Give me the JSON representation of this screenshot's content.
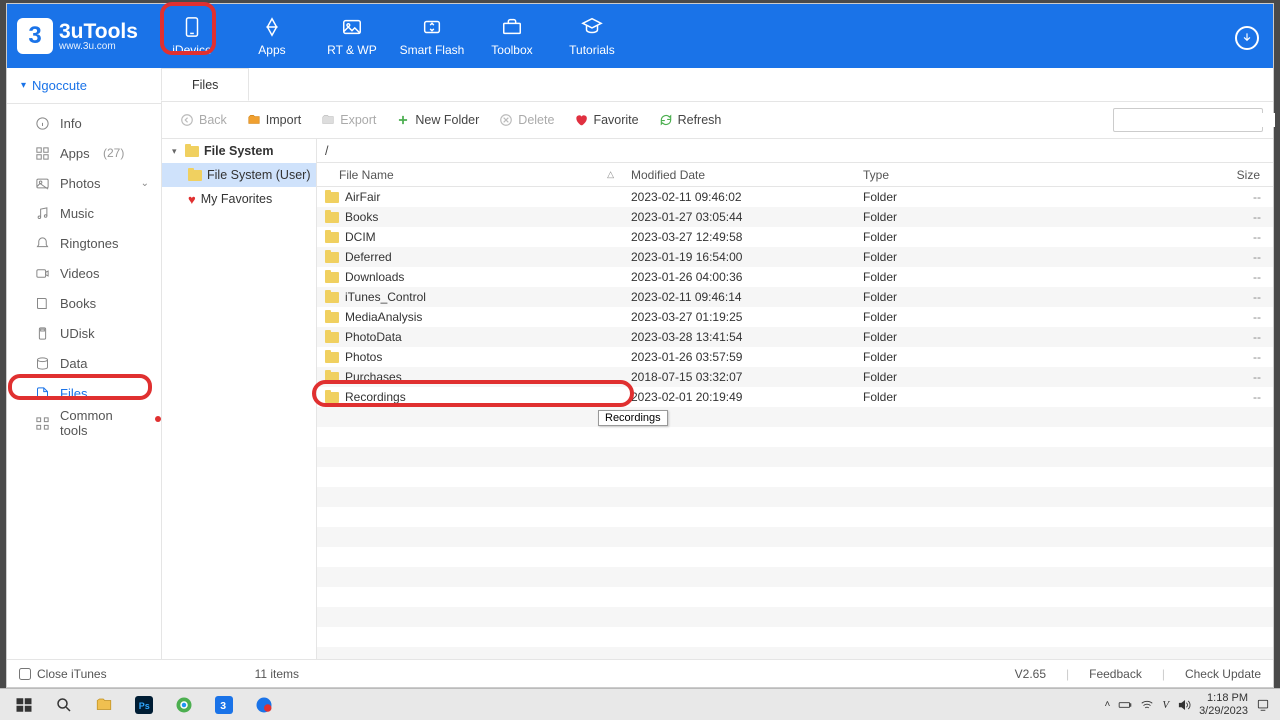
{
  "logo": {
    "badge": "3",
    "title": "3uTools",
    "sub": "www.3u.com"
  },
  "nav": [
    {
      "id": "idevice",
      "label": "iDevice"
    },
    {
      "id": "apps",
      "label": "Apps"
    },
    {
      "id": "rtwp",
      "label": "RT & WP"
    },
    {
      "id": "flash",
      "label": "Smart Flash"
    },
    {
      "id": "toolbox",
      "label": "Toolbox"
    },
    {
      "id": "tutorials",
      "label": "Tutorials"
    }
  ],
  "device": "Ngoccute",
  "sidebar": [
    {
      "id": "info",
      "label": "Info"
    },
    {
      "id": "apps",
      "label": "Apps",
      "count": "(27)"
    },
    {
      "id": "photos",
      "label": "Photos",
      "chev": true
    },
    {
      "id": "music",
      "label": "Music"
    },
    {
      "id": "ringtones",
      "label": "Ringtones"
    },
    {
      "id": "videos",
      "label": "Videos"
    },
    {
      "id": "books",
      "label": "Books"
    },
    {
      "id": "udisk",
      "label": "UDisk"
    },
    {
      "id": "data",
      "label": "Data"
    },
    {
      "id": "files",
      "label": "Files",
      "selected": true
    },
    {
      "id": "common",
      "label": "Common tools",
      "dot": true
    }
  ],
  "tab": "Files",
  "toolbar": {
    "back": "Back",
    "import": "Import",
    "export": "Export",
    "newfolder": "New Folder",
    "delete": "Delete",
    "favorite": "Favorite",
    "refresh": "Refresh"
  },
  "tree": {
    "root": "File System",
    "user": "File System (User)",
    "fav": "My Favorites"
  },
  "path": "/",
  "columns": {
    "name": "File Name",
    "date": "Modified Date",
    "type": "Type",
    "size": "Size"
  },
  "rows": [
    {
      "name": "AirFair",
      "date": "2023-02-11 09:46:02",
      "type": "Folder",
      "size": "--"
    },
    {
      "name": "Books",
      "date": "2023-01-27 03:05:44",
      "type": "Folder",
      "size": "--"
    },
    {
      "name": "DCIM",
      "date": "2023-03-27 12:49:58",
      "type": "Folder",
      "size": "--"
    },
    {
      "name": "Deferred",
      "date": "2023-01-19 16:54:00",
      "type": "Folder",
      "size": "--"
    },
    {
      "name": "Downloads",
      "date": "2023-01-26 04:00:36",
      "type": "Folder",
      "size": "--"
    },
    {
      "name": "iTunes_Control",
      "date": "2023-02-11 09:46:14",
      "type": "Folder",
      "size": "--"
    },
    {
      "name": "MediaAnalysis",
      "date": "2023-03-27 01:19:25",
      "type": "Folder",
      "size": "--"
    },
    {
      "name": "PhotoData",
      "date": "2023-03-28 13:41:54",
      "type": "Folder",
      "size": "--"
    },
    {
      "name": "Photos",
      "date": "2023-01-26 03:57:59",
      "type": "Folder",
      "size": "--"
    },
    {
      "name": "Purchases",
      "date": "2018-07-15 03:32:07",
      "type": "Folder",
      "size": "--"
    },
    {
      "name": "Recordings",
      "date": "2023-02-01 20:19:49",
      "type": "Folder",
      "size": "--"
    }
  ],
  "tooltip": "Recordings",
  "status": {
    "close_itunes": "Close iTunes",
    "count": "11 items",
    "version": "V2.65",
    "feedback": "Feedback",
    "update": "Check Update"
  },
  "clock": {
    "time": "1:18 PM",
    "date": "3/29/2023"
  }
}
